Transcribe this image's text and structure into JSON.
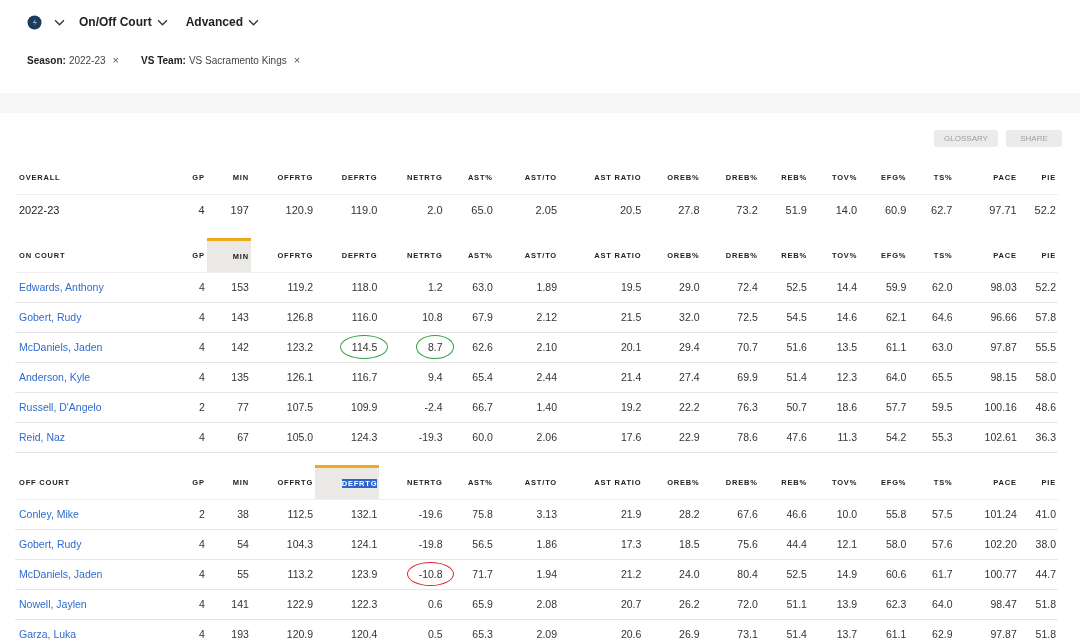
{
  "toolbar": {
    "menus": [
      {
        "label": "On/Off Court"
      },
      {
        "label": "Advanced"
      }
    ]
  },
  "filters": [
    {
      "key": "Season:",
      "value": "2022-23",
      "remove": "×"
    },
    {
      "key": "VS Team:",
      "value": "VS Sacramento Kings",
      "remove": "×"
    }
  ],
  "actions": [
    "GLOSSARY",
    "SHARE"
  ],
  "tables": [
    {
      "columns": [
        {
          "label": "OVERALL",
          "sorted": false,
          "highlighted": false
        },
        {
          "label": "GP",
          "sorted": false,
          "highlighted": false
        },
        {
          "label": "MIN",
          "sorted": false,
          "highlighted": false
        },
        {
          "label": "OFFRTG",
          "sorted": false,
          "highlighted": false
        },
        {
          "label": "DEFRTG",
          "sorted": false,
          "highlighted": false
        },
        {
          "label": "NETRTG",
          "sorted": false,
          "highlighted": false
        },
        {
          "label": "AST%",
          "sorted": false,
          "highlighted": false
        },
        {
          "label": "AST/TO",
          "sorted": false,
          "highlighted": false
        },
        {
          "label": "AST RATIO",
          "sorted": false,
          "highlighted": false
        },
        {
          "label": "OREB%",
          "sorted": false,
          "highlighted": false
        },
        {
          "label": "DREB%",
          "sorted": false,
          "highlighted": false
        },
        {
          "label": "REB%",
          "sorted": false,
          "highlighted": false
        },
        {
          "label": "TOV%",
          "sorted": false,
          "highlighted": false
        },
        {
          "label": "EFG%",
          "sorted": false,
          "highlighted": false
        },
        {
          "label": "TS%",
          "sorted": false,
          "highlighted": false
        },
        {
          "label": "PACE",
          "sorted": false,
          "highlighted": false
        },
        {
          "label": "PIE",
          "sorted": false,
          "highlighted": false
        }
      ],
      "rows": [
        {
          "name": "2022-23",
          "link": false,
          "values": [
            "4",
            "197",
            "120.9",
            "119.0",
            "2.0",
            "65.0",
            "2.05",
            "20.5",
            "27.8",
            "73.2",
            "51.9",
            "14.0",
            "60.9",
            "62.7",
            "97.71",
            "52.2"
          ]
        }
      ]
    },
    {
      "columns": [
        {
          "label": "ON COURT",
          "sorted": false,
          "highlighted": false
        },
        {
          "label": "GP",
          "sorted": false,
          "highlighted": false
        },
        {
          "label": "MIN",
          "sorted": true,
          "highlighted": false
        },
        {
          "label": "OFFRTG",
          "sorted": false,
          "highlighted": false
        },
        {
          "label": "DEFRTG",
          "sorted": false,
          "highlighted": false
        },
        {
          "label": "NETRTG",
          "sorted": false,
          "highlighted": false
        },
        {
          "label": "AST%",
          "sorted": false,
          "highlighted": false
        },
        {
          "label": "AST/TO",
          "sorted": false,
          "highlighted": false
        },
        {
          "label": "AST RATIO",
          "sorted": false,
          "highlighted": false
        },
        {
          "label": "OREB%",
          "sorted": false,
          "highlighted": false
        },
        {
          "label": "DREB%",
          "sorted": false,
          "highlighted": false
        },
        {
          "label": "REB%",
          "sorted": false,
          "highlighted": false
        },
        {
          "label": "TOV%",
          "sorted": false,
          "highlighted": false
        },
        {
          "label": "EFG%",
          "sorted": false,
          "highlighted": false
        },
        {
          "label": "TS%",
          "sorted": false,
          "highlighted": false
        },
        {
          "label": "PACE",
          "sorted": false,
          "highlighted": false
        },
        {
          "label": "PIE",
          "sorted": false,
          "highlighted": false
        }
      ],
      "rows": [
        {
          "name": "Edwards, Anthony",
          "link": true,
          "values": [
            "4",
            "153",
            "119.2",
            "118.0",
            "1.2",
            "63.0",
            "1.89",
            "19.5",
            "29.0",
            "72.4",
            "52.5",
            "14.4",
            "59.9",
            "62.0",
            "98.03",
            "52.2"
          ]
        },
        {
          "name": "Gobert, Rudy",
          "link": true,
          "values": [
            "4",
            "143",
            "126.8",
            "116.0",
            "10.8",
            "67.9",
            "2.12",
            "21.5",
            "32.0",
            "72.5",
            "54.5",
            "14.6",
            "62.1",
            "64.6",
            "96.66",
            "57.8"
          ]
        },
        {
          "name": "McDaniels, Jaden",
          "link": true,
          "values": [
            "4",
            "142",
            "123.2",
            {
              "text": "114.5",
              "color": "#2ea043"
            },
            {
              "text": "8.7",
              "color": "#2ea043"
            },
            "62.6",
            "2.10",
            "20.1",
            "29.4",
            "70.7",
            "51.6",
            "13.5",
            "61.1",
            "63.0",
            "97.87",
            "55.5"
          ]
        },
        {
          "name": "Anderson, Kyle",
          "link": true,
          "values": [
            "4",
            "135",
            "126.1",
            "116.7",
            "9.4",
            "65.4",
            "2.44",
            "21.4",
            "27.4",
            "69.9",
            "51.4",
            "12.3",
            "64.0",
            "65.5",
            "98.15",
            "58.0"
          ]
        },
        {
          "name": "Russell, D'Angelo",
          "link": true,
          "values": [
            "2",
            "77",
            "107.5",
            "109.9",
            "-2.4",
            "66.7",
            "1.40",
            "19.2",
            "22.2",
            "76.3",
            "50.7",
            "18.6",
            "57.7",
            "59.5",
            "100.16",
            "48.6"
          ]
        },
        {
          "name": "Reid, Naz",
          "link": true,
          "values": [
            "4",
            "67",
            "105.0",
            "124.3",
            "-19.3",
            "60.0",
            "2.06",
            "17.6",
            "22.9",
            "78.6",
            "47.6",
            "11.3",
            "54.2",
            "55.3",
            "102.61",
            "36.3"
          ]
        }
      ]
    },
    {
      "columns": [
        {
          "label": "OFF COURT",
          "sorted": false,
          "highlighted": false
        },
        {
          "label": "GP",
          "sorted": false,
          "highlighted": false
        },
        {
          "label": "MIN",
          "sorted": false,
          "highlighted": false
        },
        {
          "label": "OFFRTG",
          "sorted": false,
          "highlighted": false
        },
        {
          "label": "DEFRTG",
          "sorted": true,
          "highlighted": true
        },
        {
          "label": "NETRTG",
          "sorted": false,
          "highlighted": false
        },
        {
          "label": "AST%",
          "sorted": false,
          "highlighted": false
        },
        {
          "label": "AST/TO",
          "sorted": false,
          "highlighted": false
        },
        {
          "label": "AST RATIO",
          "sorted": false,
          "highlighted": false
        },
        {
          "label": "OREB%",
          "sorted": false,
          "highlighted": false
        },
        {
          "label": "DREB%",
          "sorted": false,
          "highlighted": false
        },
        {
          "label": "REB%",
          "sorted": false,
          "highlighted": false
        },
        {
          "label": "TOV%",
          "sorted": false,
          "highlighted": false
        },
        {
          "label": "EFG%",
          "sorted": false,
          "highlighted": false
        },
        {
          "label": "TS%",
          "sorted": false,
          "highlighted": false
        },
        {
          "label": "PACE",
          "sorted": false,
          "highlighted": false
        },
        {
          "label": "PIE",
          "sorted": false,
          "highlighted": false
        }
      ],
      "rows": [
        {
          "name": "Conley, Mike",
          "link": true,
          "values": [
            "2",
            "38",
            "112.5",
            "132.1",
            "-19.6",
            "75.8",
            "3.13",
            "21.9",
            "28.2",
            "67.6",
            "46.6",
            "10.0",
            "55.8",
            "57.5",
            "101.24",
            "41.0"
          ]
        },
        {
          "name": "Gobert, Rudy",
          "link": true,
          "values": [
            "4",
            "54",
            "104.3",
            "124.1",
            "-19.8",
            "56.5",
            "1.86",
            "17.3",
            "18.5",
            "75.6",
            "44.4",
            "12.1",
            "58.0",
            "57.6",
            "102.20",
            "38.0"
          ]
        },
        {
          "name": "McDaniels, Jaden",
          "link": true,
          "values": [
            "4",
            "55",
            "113.2",
            "123.9",
            {
              "text": "-10.8",
              "color": "#e0242b"
            },
            "71.7",
            "1.94",
            "21.2",
            "24.0",
            "80.4",
            "52.5",
            "14.9",
            "60.6",
            "61.7",
            "100.77",
            "44.7"
          ]
        },
        {
          "name": "Nowell, Jaylen",
          "link": true,
          "values": [
            "4",
            "141",
            "122.9",
            "122.3",
            "0.6",
            "65.9",
            "2.08",
            "20.7",
            "26.2",
            "72.0",
            "51.1",
            "13.9",
            "62.3",
            "64.0",
            "98.47",
            "51.8"
          ]
        },
        {
          "name": "Garza, Luka",
          "link": true,
          "values": [
            "4",
            "193",
            "120.9",
            "120.4",
            "0.5",
            "65.3",
            "2.09",
            "20.6",
            "26.9",
            "73.1",
            "51.4",
            "13.7",
            "61.1",
            "62.9",
            "97.87",
            "51.8"
          ]
        }
      ]
    }
  ]
}
